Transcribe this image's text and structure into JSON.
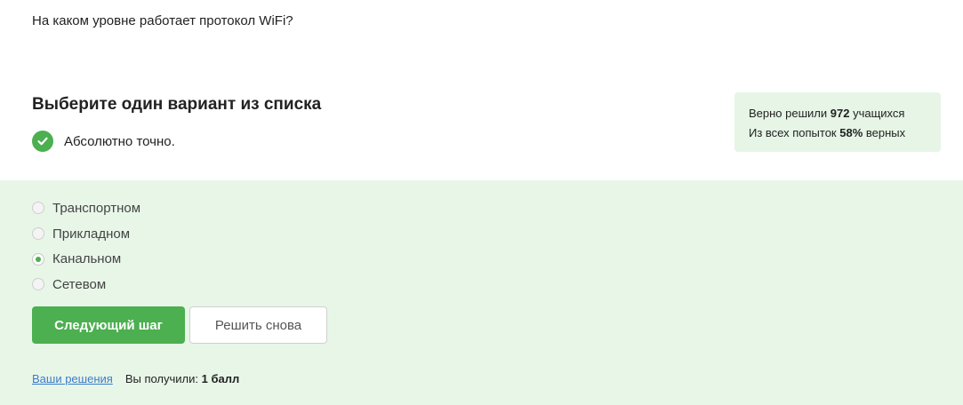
{
  "question": {
    "text": "На каком уровне работает протокол WiFi?"
  },
  "instruction": "Выберите один вариант из списка",
  "feedback": {
    "icon": "check-circle-icon",
    "text": "Абсолютно точно."
  },
  "stats": {
    "line1_prefix": "Верно решили ",
    "line1_count": "972",
    "line1_suffix": " учащихся",
    "line2_prefix": "Из всех попыток ",
    "line2_percent": "58%",
    "line2_suffix": " верных"
  },
  "options": [
    {
      "label": "Транспортном",
      "selected": false
    },
    {
      "label": "Прикладном",
      "selected": false
    },
    {
      "label": "Канальном",
      "selected": true
    },
    {
      "label": "Сетевом",
      "selected": false
    }
  ],
  "buttons": {
    "next": "Следующий шаг",
    "retry": "Решить снова"
  },
  "footer": {
    "solutions_link": "Ваши решения",
    "score_prefix": "Вы получили: ",
    "score_value": "1 балл"
  },
  "colors": {
    "accent": "#4caf50",
    "answer_bg": "#e8f6e8",
    "stats_bg": "#e6f5e6",
    "link": "#3b7cc9"
  }
}
